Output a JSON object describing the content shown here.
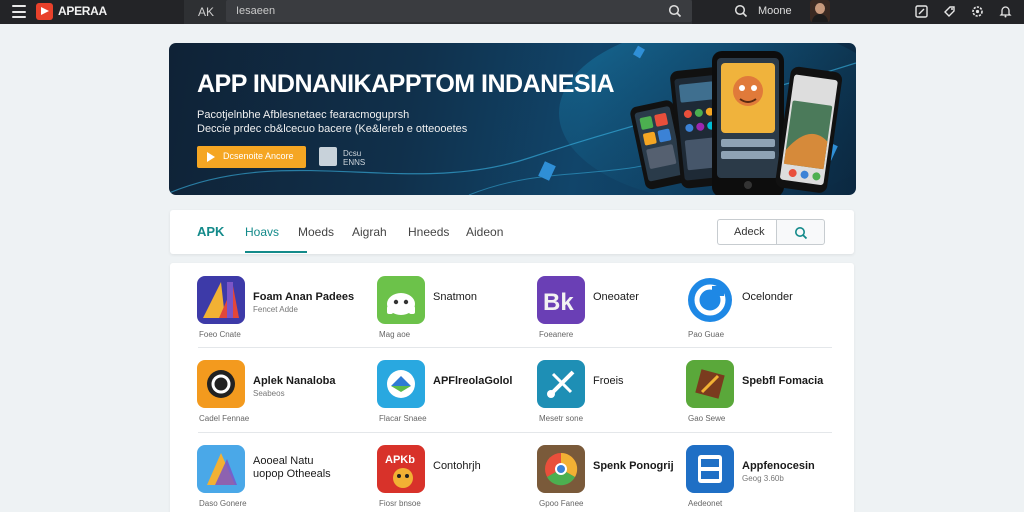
{
  "topbar": {
    "logo_text": "APERAA",
    "section_label": "AK",
    "search_placeholder": "Iesaeen",
    "user_name": "Moone"
  },
  "banner": {
    "title": "APP INDNANIKAPPTOM INDANESIA",
    "subtitle_line1": "Pacotjelnbhe Afblesnetaec fearacmoguprsh",
    "subtitle_line2": "Deccie prdec cb&lcecuo bacere (Ke&lereb e otteooetes",
    "cta_label": "Dcsenoite Ancore",
    "qr_label": "Dcsu ENNS"
  },
  "tabs": {
    "items": [
      "APK",
      "Hoavs",
      "Moeds",
      "Aigrah",
      "Hneeds",
      "Aideon"
    ],
    "active": "Hoavs",
    "search_label": "Adeck"
  },
  "apps": [
    {
      "name": "Foam Anan Padees",
      "sub": "Fencet Adde",
      "meta": "Foeo Cnate",
      "bold": true
    },
    {
      "name": "Snatmon",
      "sub": "",
      "meta": "Mag aoe",
      "bold": false
    },
    {
      "name": "Oneoater",
      "sub": "",
      "meta": "Foeanere",
      "bold": false
    },
    {
      "name": "Ocelonder",
      "sub": "",
      "meta": "Pao Guae",
      "bold": false
    },
    {
      "name": "Aplek Nanaloba",
      "sub": "Seabeos",
      "meta": "Cadel Fennae",
      "bold": true
    },
    {
      "name": "APFlreolaGolol",
      "sub": "",
      "meta": "Flacar Snaee",
      "bold": true
    },
    {
      "name": "Froeis",
      "sub": "",
      "meta": "Mesetr sone",
      "bold": false
    },
    {
      "name": "Spebfl Fomacia",
      "sub": "",
      "meta": "Gao Sewe",
      "bold": true
    },
    {
      "name": "Aooeal Natu\nuopop Otheeals",
      "sub": "",
      "meta": "Daso Gonere",
      "bold": false
    },
    {
      "name": "Contohrjh",
      "sub": "",
      "meta": "Fiosr bnsoe",
      "bold": false
    },
    {
      "name": "Spenk Ponogrij",
      "sub": "",
      "meta": "Gpoo Fanee",
      "bold": true
    },
    {
      "name": "Appfenocesin",
      "sub": "Geog 3.60b",
      "meta": "Aedeonet",
      "bold": true
    }
  ],
  "colors": {
    "accent": "#138a8a",
    "cta": "#f5a623",
    "topbar": "#232427",
    "banner": "#10304b"
  }
}
